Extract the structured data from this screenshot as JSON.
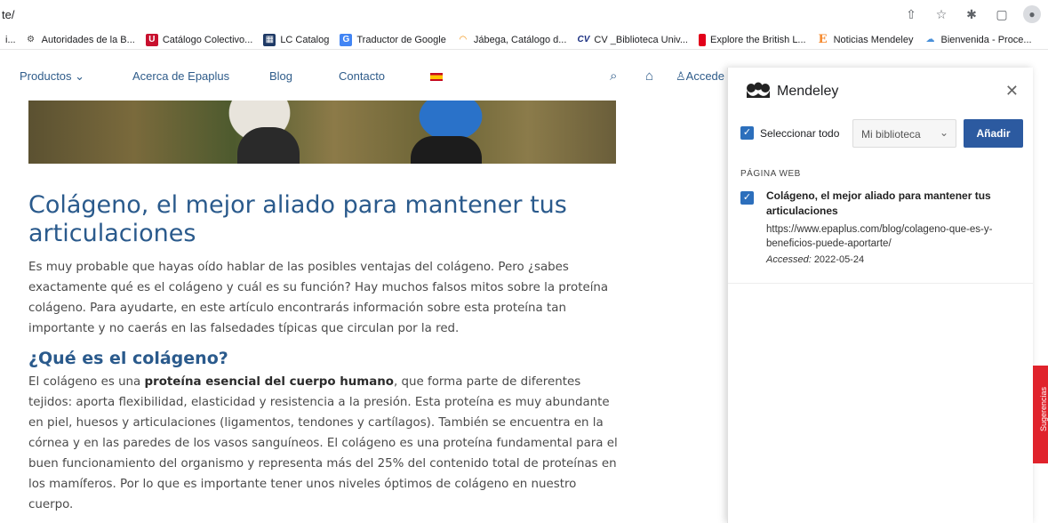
{
  "browser": {
    "url": "te/",
    "bookmarks": [
      {
        "label": "Autoridades de la B...",
        "icon": "bne-icon",
        "color": "#444"
      },
      {
        "label": "Catálogo Colectivo...",
        "icon": "ccpb-icon",
        "color": "#c8102e"
      },
      {
        "label": "LC Catalog",
        "icon": "lc-icon",
        "color": "#1f3a66"
      },
      {
        "label": "Traductor de Google",
        "icon": "google-translate-icon",
        "color": "#4285f4"
      },
      {
        "label": "Jábega, Catálogo d...",
        "icon": "jabega-icon",
        "color": "#f08a00"
      },
      {
        "label": "CV _Biblioteca Univ...",
        "icon": "cv-icon",
        "color": "#1a2f80"
      },
      {
        "label": "Explore the British L...",
        "icon": "british-library-icon",
        "color": "#e2001a"
      },
      {
        "label": "Noticias Mendeley",
        "icon": "elsevier-icon",
        "color": "#f5872a"
      },
      {
        "label": "Bienvenida - Proce...",
        "icon": "cloud-icon",
        "color": "#4a90d9"
      }
    ]
  },
  "nav": {
    "productos": "Productos",
    "acerca": "Acerca de Epaplus",
    "blog": "Blog",
    "contacto": "Contacto",
    "acceder": "Accede"
  },
  "article": {
    "title": "Colágeno, el mejor aliado para mantener tus articulaciones",
    "intro": "Es muy probable que hayas oído hablar de las posibles ventajas del colágeno. Pero ¿sabes exactamente qué es el colágeno y cuál es su función? Hay muchos falsos mitos sobre la proteína colágeno. Para ayudarte, en este artículo encontrarás información sobre esta proteína tan importante y no caerás en las falsedades típicas que circulan por la red.",
    "subtitle": "¿Qué es el colágeno?",
    "body_pre": "El colágeno es una ",
    "body_bold": "proteína esencial del cuerpo humano",
    "body_post": ", que forma parte de diferentes tejidos: aporta flexibilidad, elasticidad y resistencia a la presión. Esta proteína es muy abundante en piel, huesos y articulaciones (ligamentos, tendones y cartílagos). También se encuentra en la córnea y en las paredes de los vasos sanguíneos. El colágeno es una proteína fundamental para el buen funcionamiento del organismo y representa más del 25% del contenido total de proteínas en los mamíferos. Por lo que es importante tener unos niveles óptimos de colágeno en nuestro cuerpo."
  },
  "mendeley": {
    "title": "Mendeley",
    "select_all": "Seleccionar todo",
    "library": "Mi biblioteca",
    "add": "Añadir",
    "section": "PÁGINA WEB",
    "item_title": "Colágeno, el mejor aliado para mantener tus articulaciones",
    "item_url": "https://www.epaplus.com/blog/colageno-que-es-y-beneficios-puede-aportarte/",
    "accessed_label": "Accessed:",
    "accessed_date": "2022-05-24"
  },
  "sugerencias": "Sugerencias",
  "colors": {
    "accent": "#2a5a8c",
    "mendeley_blue": "#2c5aa0",
    "sug_red": "#e0232c"
  }
}
